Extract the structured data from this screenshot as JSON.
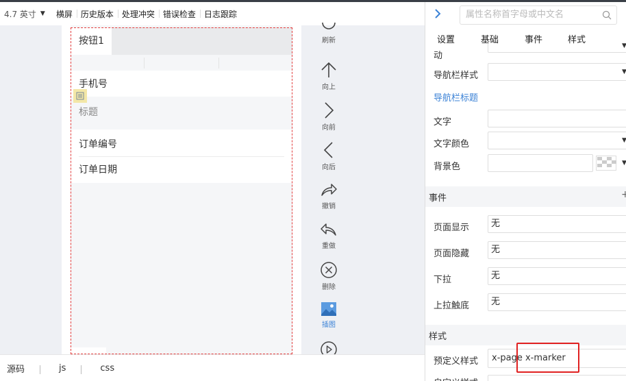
{
  "toolbar": {
    "device": "4.7 英寸",
    "items": [
      "横屏",
      "历史版本",
      "处理冲突",
      "错误检查",
      "日志跟踪"
    ]
  },
  "phone": {
    "tab_button": "按钮1",
    "fields": [
      {
        "label": "手机号"
      },
      {
        "label": "标题"
      },
      {
        "label": "订单编号"
      },
      {
        "label": "订单日期"
      }
    ]
  },
  "tools": [
    {
      "label": "刷新",
      "icon": "refresh-icon"
    },
    {
      "label": "向上",
      "icon": "arrow-up-icon"
    },
    {
      "label": "向前",
      "icon": "chevron-right-icon"
    },
    {
      "label": "向后",
      "icon": "chevron-left-icon"
    },
    {
      "label": "撤销",
      "icon": "undo-icon"
    },
    {
      "label": "重做",
      "icon": "redo-icon"
    },
    {
      "label": "删除",
      "icon": "delete-icon"
    },
    {
      "label": "插图",
      "icon": "image-icon"
    },
    {
      "label": "",
      "icon": "play-icon"
    }
  ],
  "bottom_tabs": [
    "源码",
    "js",
    "css"
  ],
  "panel": {
    "search_placeholder": "属性名称首字母或中文名",
    "tabs": [
      "设置",
      "基础",
      "事件",
      "样式"
    ],
    "partial_label": "动",
    "nav_style_label": "导航栏样式",
    "nav_title_section": "导航栏标题",
    "text_label": "文字",
    "text_color_label": "文字颜色",
    "bg_color_label": "背景色",
    "events_section": "事件",
    "events_add": "+",
    "events": [
      {
        "label": "页面显示",
        "value": "无"
      },
      {
        "label": "页面隐藏",
        "value": "无"
      },
      {
        "label": "下拉",
        "value": "无"
      },
      {
        "label": "上拉触底",
        "value": "无"
      }
    ],
    "style_section": "样式",
    "predefined_label": "预定义样式",
    "predefined_value": "x-page x-marker",
    "custom_label": "自定义样式"
  },
  "colors": {
    "accent": "#3b82d6",
    "highlight": "#e02020",
    "dashed_border": "#e23b3b"
  }
}
